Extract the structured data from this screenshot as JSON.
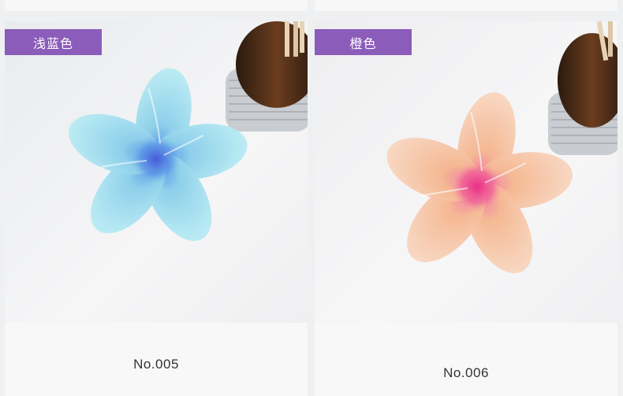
{
  "products": [
    {
      "color_label": "浅蓝色",
      "code": "No.005",
      "petal_color": "#9ee0ee",
      "center_color": "#2a6ee0"
    },
    {
      "color_label": "橙色",
      "code": "No.006",
      "petal_color": "#f7c7a6",
      "center_color": "#ef2d8a"
    }
  ],
  "tag_background": "#8b5cba"
}
